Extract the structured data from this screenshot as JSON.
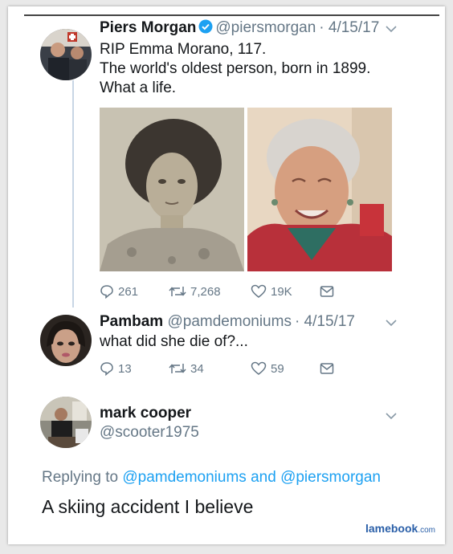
{
  "tweets": [
    {
      "name": "Piers Morgan",
      "handle": "@piersmorgan",
      "date": "· 4/15/17",
      "text": "RIP Emma Morano, 117.\nThe world's oldest person, born in 1899.\nWhat a life.",
      "replies": "261",
      "retweets": "7,268",
      "likes": "19K",
      "verified": true
    },
    {
      "name": "Pambam",
      "handle": "@pamdemoniums",
      "date": "· 4/15/17",
      "text": "what did she die of?...",
      "replies": "13",
      "retweets": "34",
      "likes": "59"
    }
  ],
  "reply": {
    "name": "mark cooper",
    "handle": "@scooter1975",
    "replying_label": "Replying to",
    "mention_1": "@pamdemoniums",
    "and_label": "and",
    "mention_2": "@piersmorgan",
    "text": "A skiing accident I believe"
  },
  "watermark": {
    "main": "lamebook",
    "suffix": ".com"
  },
  "colors": {
    "link": "#1da1f2",
    "muted": "#657786",
    "verified": "#1da1f2",
    "thread_line": "#c8d6e5"
  },
  "icons": [
    "reply-icon",
    "retweet-icon",
    "heart-icon",
    "message-icon",
    "verified-badge-icon",
    "chevron-down-icon"
  ]
}
